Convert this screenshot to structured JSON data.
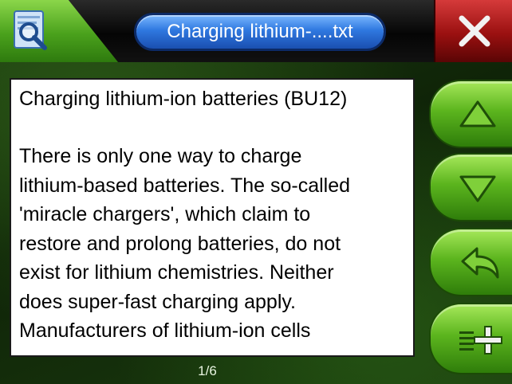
{
  "header": {
    "title": "Charging lithium-....txt",
    "app_icon": "document-magnifier-icon",
    "close_icon": "close-icon"
  },
  "document": {
    "title": "Charging lithium-ion batteries (BU12)",
    "lines": [
      "There is only one way to charge",
      "lithium-based batteries. The so-called",
      "'miracle chargers', which claim to",
      "restore and prolong batteries, do not",
      "exist for lithium chemistries. Neither",
      "does super-fast charging apply.",
      "Manufacturers of lithium-ion cells"
    ]
  },
  "sidebar": {
    "buttons": [
      {
        "name": "scroll-up",
        "icon": "triangle-up-icon"
      },
      {
        "name": "scroll-down",
        "icon": "triangle-down-icon"
      },
      {
        "name": "back",
        "icon": "back-arrow-icon"
      },
      {
        "name": "add-bookmark",
        "icon": "list-add-icon"
      }
    ]
  },
  "footer": {
    "page_indicator": "1/6"
  },
  "colors": {
    "title_pill": "#2f78e0",
    "close_button": "#b01818",
    "side_buttons": "#5cb51e",
    "background": "#163010"
  }
}
